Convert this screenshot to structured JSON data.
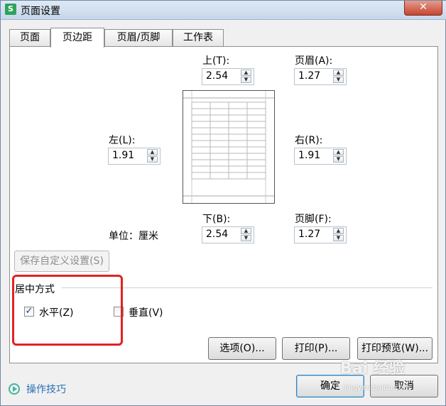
{
  "window": {
    "title": "页面设置",
    "app_icon_letter": "S",
    "close_glyph": "✕"
  },
  "tabs": [
    {
      "label": "页面"
    },
    {
      "label": "页边距"
    },
    {
      "label": "页眉/页脚"
    },
    {
      "label": "工作表"
    }
  ],
  "active_tab": "页边距",
  "margins": {
    "top": {
      "label": "上(T):",
      "value": "2.54"
    },
    "header": {
      "label": "页眉(A):",
      "value": "1.27"
    },
    "left": {
      "label": "左(L):",
      "value": "1.91"
    },
    "right": {
      "label": "右(R):",
      "value": "1.91"
    },
    "bottom": {
      "label": "下(B):",
      "value": "2.54"
    },
    "footer": {
      "label": "页脚(F):",
      "value": "1.27"
    }
  },
  "unit_text": "单位：厘米",
  "save_custom_button": "保存自定义设置(S)",
  "centering": {
    "group_label": "居中方式",
    "horizontal": {
      "label": "水平(Z)",
      "checked": true
    },
    "vertical": {
      "label": "垂直(V)",
      "checked": false
    }
  },
  "buttons": {
    "options": "选项(O)...",
    "print": "打印(P)...",
    "print_preview": "打印预览(W)...",
    "ok": "确定",
    "cancel": "取消"
  },
  "tips_link": "操作技巧",
  "watermark": {
    "main": "Bai 经验",
    "sub": "jingyan.baidu.com"
  },
  "colors": {
    "highlight": "#e32222",
    "link": "#2a6fb8",
    "tips_icon": "#45b4a0"
  }
}
